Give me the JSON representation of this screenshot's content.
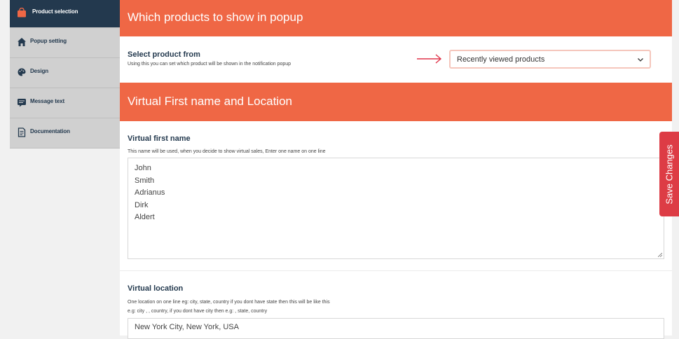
{
  "sidebar": {
    "items": [
      {
        "label": "Product selection",
        "icon": "shopping-bag-icon",
        "active": true
      },
      {
        "label": "Popup setting",
        "icon": "home-icon"
      },
      {
        "label": "Design",
        "icon": "palette-icon"
      },
      {
        "label": "Message text",
        "icon": "message-icon"
      },
      {
        "label": "Documentation",
        "icon": "document-icon"
      }
    ]
  },
  "sections": {
    "products": {
      "title": "Which products to show in popup",
      "select_label": "Select product from",
      "select_help": "Using this you can set which product will be shown in the notification popup",
      "select_value": "Recently viewed products"
    },
    "virtual": {
      "title": "Virtual First name and Location",
      "first_name_label": "Virtual first name",
      "first_name_help": "This name will be used, when you decide to show virtual sales, Enter one name on one line",
      "names": [
        "John",
        "Smith",
        "Adrianus",
        "Dirk",
        "Aldert"
      ],
      "location_label": "Virtual location",
      "location_help_1": "One location on one line eg: city, state, country if you dont have state then this will be like this",
      "location_help_2": "e.g: city , , country, if you dont have city then e.g: , state, country",
      "location_value": "New York City, New York, USA"
    }
  },
  "save_button": {
    "label": "Save Changes"
  },
  "colors": {
    "accent": "#ef6745",
    "sidebar_active": "#23394e",
    "save": "#dd3c45",
    "arrow": "#e0344a"
  }
}
